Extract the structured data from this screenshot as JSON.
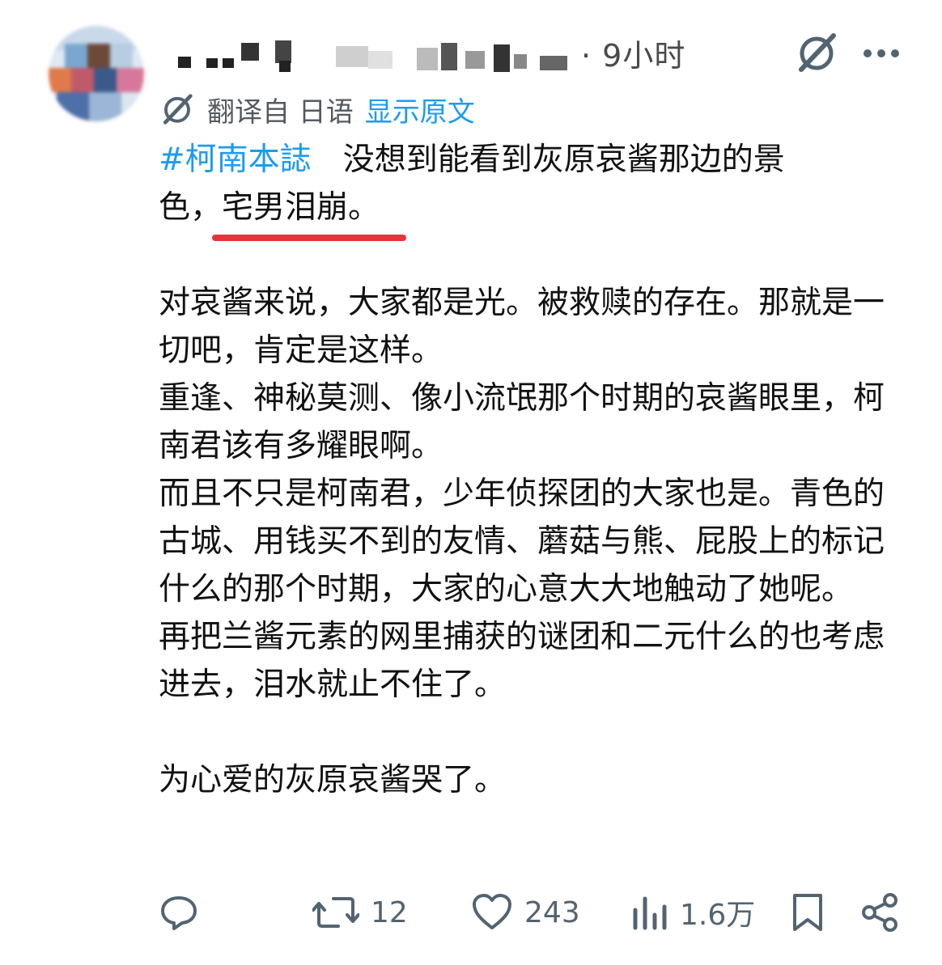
{
  "header": {
    "time": "· 9小时"
  },
  "translation": {
    "translated_from": "翻译自 日语",
    "show_original": "显示原文"
  },
  "post": {
    "hashtag": "#柯南本誌",
    "line1_rest": "　没想到能看到灰原哀酱那边的景",
    "line2_prefix": "色，",
    "line2_highlight": "宅男泪崩",
    "line2_suffix": "。",
    "para2": "对哀酱来说，大家都是光。被救赎的存在。那就是一切吧，肯定是这样。\n重逢、神秘莫测、像小流氓那个时期的哀酱眼里，柯南君该有多耀眼啊。\n而且不只是柯南君，少年侦探团的大家也是。青色的古城、用钱买不到的友情、蘑菇与熊、屁股上的标记什么的那个时期，大家的心意大大地触动了她呢。\n再把兰酱元素的网里捕获的谜团和二元什么的也考虑进去，泪水就止不住了。",
    "para3": "为心爱的灰原哀酱哭了。"
  },
  "actions": {
    "reposts": "12",
    "likes": "243",
    "views": "1.6万"
  },
  "colors": {
    "link": "#1d9bf0",
    "underline": "#e8333a",
    "meta": "#536471"
  }
}
